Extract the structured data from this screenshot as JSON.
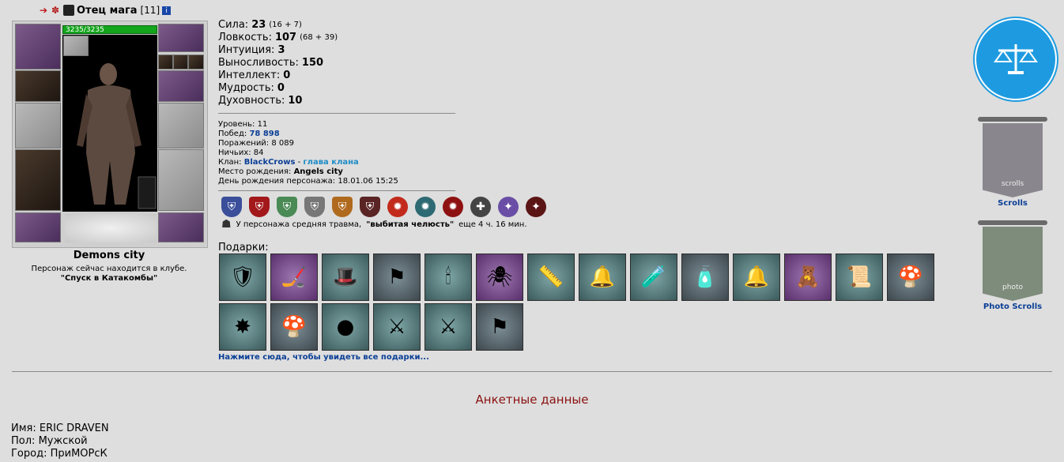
{
  "header": {
    "nick": "Отец мага",
    "level": "[11]",
    "icons": [
      "arrow-icon",
      "clan-cross-icon",
      "clan-emblem-icon",
      "info-icon"
    ]
  },
  "character": {
    "hp": "3235/3235",
    "city": "Demons city",
    "location_line": "Персонаж сейчас находится в клубе.",
    "location_name": "\"Спуск в Катакомбы\""
  },
  "stats": [
    {
      "label": "Сила:",
      "value": "23",
      "bonus": "(16 + 7)"
    },
    {
      "label": "Ловкость:",
      "value": "107",
      "bonus": "(68 + 39)"
    },
    {
      "label": "Интуиция:",
      "value": "3",
      "bonus": ""
    },
    {
      "label": "Выносливость:",
      "value": "150",
      "bonus": ""
    },
    {
      "label": "Интеллект:",
      "value": "0",
      "bonus": ""
    },
    {
      "label": "Мудрость:",
      "value": "0",
      "bonus": ""
    },
    {
      "label": "Духовность:",
      "value": "10",
      "bonus": ""
    }
  ],
  "info": {
    "level_label": "Уровень:",
    "level": "11",
    "wins_label": "Побед:",
    "wins": "78 898",
    "losses_label": "Поражений:",
    "losses": "8 089",
    "draws_label": "Ничьих:",
    "draws": "84",
    "clan_label": "Клан:",
    "clan": "BlackCrows",
    "clan_sep": "-",
    "clan_role": "глава клана",
    "birthplace_label": "Место рождения:",
    "birthplace": "Angels city",
    "birthday_label": "День рождения персонажа:",
    "birthday": "18.01.06 15:25"
  },
  "badges": [
    "shield-blue-icon",
    "shield-red-icon",
    "shield-green-icon",
    "shield-grey-icon",
    "shield-orange-icon",
    "shield-dark-icon",
    "medal-red-icon",
    "medal-teal-icon",
    "medal-crimson-icon",
    "medal-cross-icon",
    "medal-purple-icon",
    "medal-demon-icon"
  ],
  "trauma": {
    "text": "У персонажа средняя травма,",
    "name": "\"выбитая челюсть\"",
    "rest": "еще 4 ч. 16 мин."
  },
  "gifts": {
    "label": "Подарки:",
    "items": [
      {
        "icon": "shield-gift-icon",
        "glyph": "🛡",
        "bg": "g-teal"
      },
      {
        "icon": "hockey-stick-icon",
        "glyph": "🏒",
        "bg": "g-purple"
      },
      {
        "icon": "jester-hat-icon",
        "glyph": "🎩",
        "bg": "g-teal"
      },
      {
        "icon": "banner-gift-icon",
        "glyph": "⚑",
        "bg": "g-slate"
      },
      {
        "icon": "candle-icon",
        "glyph": "🕯",
        "bg": "g-teal"
      },
      {
        "icon": "spider-icon",
        "glyph": "🕷",
        "bg": "g-purple"
      },
      {
        "icon": "ruler-icon",
        "glyph": "📏",
        "bg": "g-teal"
      },
      {
        "icon": "bell-icon",
        "glyph": "🔔",
        "bg": "g-teal"
      },
      {
        "icon": "potion-icon",
        "glyph": "🧪",
        "bg": "g-teal"
      },
      {
        "icon": "vaseline-tube-icon",
        "glyph": "🧴",
        "bg": "g-slate"
      },
      {
        "icon": "christmas-bells-icon",
        "glyph": "🔔",
        "bg": "g-teal"
      },
      {
        "icon": "teddy-bear-icon",
        "glyph": "🧸",
        "bg": "g-purple"
      },
      {
        "icon": "scroll-note-icon",
        "glyph": "📜",
        "bg": "g-teal"
      },
      {
        "icon": "blue-mushroom-icon",
        "glyph": "🍄",
        "bg": "g-slate"
      },
      {
        "icon": "spiked-mace-icon",
        "glyph": "✸",
        "bg": "g-teal"
      },
      {
        "icon": "blue-mushroom-icon",
        "glyph": "🍄",
        "bg": "g-slate"
      },
      {
        "icon": "orange-stone-icon",
        "glyph": "●",
        "bg": "g-teal"
      },
      {
        "icon": "crossed-swords-icon",
        "glyph": "⚔",
        "bg": "g-teal"
      },
      {
        "icon": "crossed-swords-icon",
        "glyph": "⚔",
        "bg": "g-teal"
      },
      {
        "icon": "banner-gift-icon",
        "glyph": "⚑",
        "bg": "g-slate"
      }
    ],
    "all_link": "Нажмите сюда, чтобы увидеть все подарки..."
  },
  "anketa_title": "Анкетные данные",
  "personal": {
    "name_label": "Имя:",
    "name": "ERIC DRAVEN",
    "sex_label": "Пол:",
    "sex": "Мужской",
    "city_label": "Город:",
    "city": "ПриМОРсК"
  },
  "sidebar": {
    "scrolls_label": "Scrolls",
    "scrolls_banner_text": "scrolls",
    "photo_label": "Photo Scrolls",
    "photo_banner_text": "photo"
  }
}
